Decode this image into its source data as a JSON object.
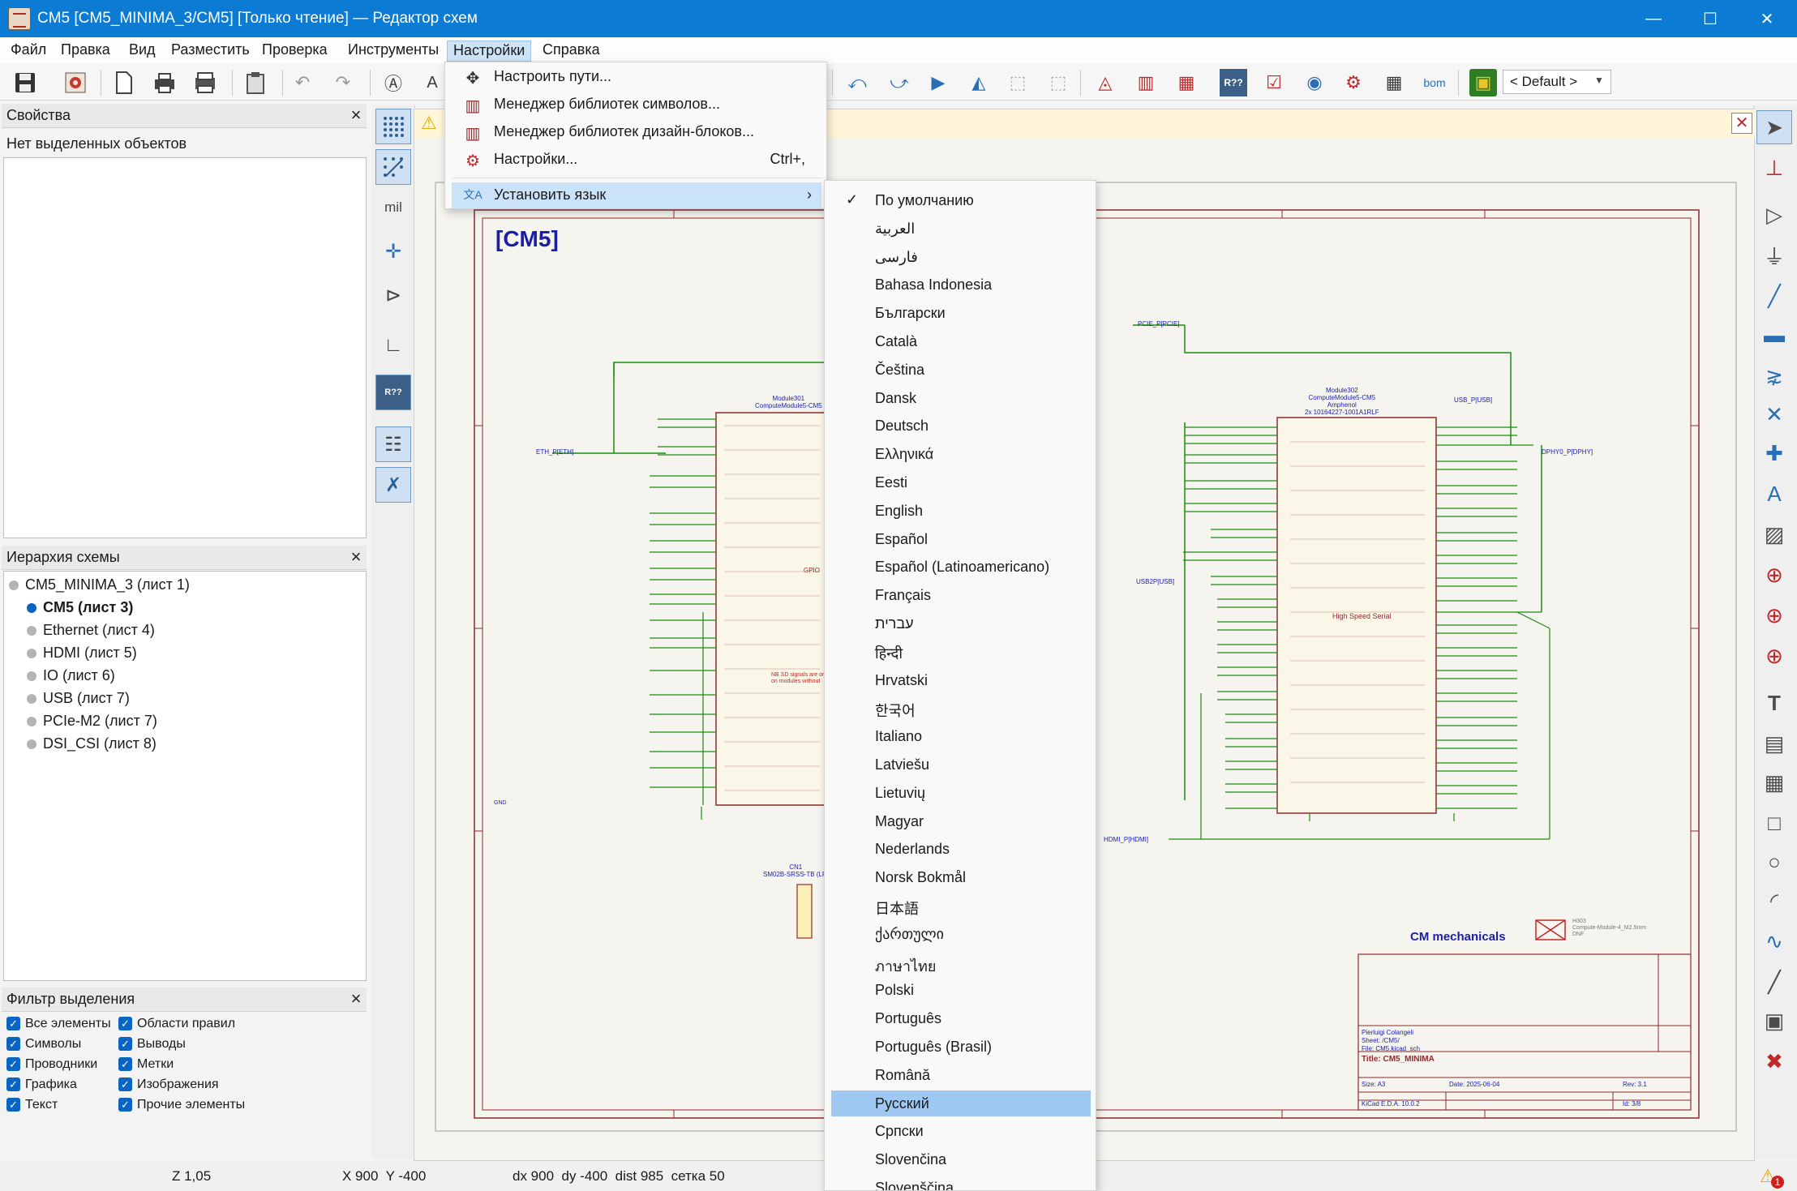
{
  "window": {
    "title": "CM5 [CM5_MINIMA_3/CM5] [Только чтение] — Редактор схем",
    "minimize": "—",
    "maximize": "☐",
    "close": "✕"
  },
  "menubar": [
    "Файл",
    "Правка",
    "Вид",
    "Разместить",
    "Проверка",
    "Инструменты",
    "Настройки",
    "Справка"
  ],
  "toolbar": {
    "scheme_dropdown": "< Default >"
  },
  "properties_panel": {
    "title": "Свойства",
    "empty_text": "Нет выделенных объектов"
  },
  "hierarchy_panel": {
    "title": "Иерархия схемы",
    "items": [
      {
        "label": "CM5_MINIMA_3 (лист 1)",
        "level": 0
      },
      {
        "label": "CM5 (лист 3)",
        "level": 1,
        "current": true
      },
      {
        "label": "Ethernet (лист 4)",
        "level": 1
      },
      {
        "label": "HDMI (лист 5)",
        "level": 1
      },
      {
        "label": "IO (лист 6)",
        "level": 1
      },
      {
        "label": "USB (лист 7)",
        "level": 1
      },
      {
        "label": "PCIe-M2 (лист 7)",
        "level": 1
      },
      {
        "label": "DSI_CSI (лист 8)",
        "level": 1
      }
    ]
  },
  "filter_panel": {
    "title": "Фильтр выделения",
    "left": [
      "Все элементы",
      "Символы",
      "Проводники",
      "Графика",
      "Текст"
    ],
    "right": [
      "Области правил",
      "Выводы",
      "Метки",
      "Изображения",
      "Прочие элементы"
    ]
  },
  "settings_menu": {
    "items": [
      {
        "icon": "move-arrows-icon",
        "label": "Настроить пути...",
        "shortcut": ""
      },
      {
        "icon": "library-icon",
        "label": "Менеджер библиотек символов...",
        "shortcut": ""
      },
      {
        "icon": "library-icon",
        "label": "Менеджер библиотек дизайн-блоков...",
        "shortcut": ""
      },
      {
        "icon": "gear-icon",
        "label": "Настройки...",
        "shortcut": "Ctrl+,"
      },
      {
        "icon": "language-icon",
        "label": "Установить язык",
        "shortcut": "",
        "submenu": true
      }
    ]
  },
  "language_menu": {
    "checked_index": 0,
    "highlighted_index": 32,
    "items": [
      "По умолчанию",
      "العربية",
      "فارسی",
      "Bahasa Indonesia",
      "Български",
      "Català",
      "Čeština",
      "Dansk",
      "Deutsch",
      "Ελληνικά",
      "Eesti",
      "English",
      "Español",
      "Español (Latinoamericano)",
      "Français",
      "עברית",
      "हिन्दी",
      "Hrvatski",
      "한국어",
      "Italiano",
      "Latviešu",
      "Lietuvių",
      "Magyar",
      "Nederlands",
      "Norsk Bokmål",
      "日本語",
      "ქართული",
      "ภาษาไทย",
      "Polski",
      "Português",
      "Português (Brasil)",
      "Română",
      "Русский",
      "Српски",
      "Slovenčina",
      "Slovenščina"
    ]
  },
  "canvas": {
    "sheet_title": "[CM5]",
    "module_left": "Module301\nComputeModule5-CM5",
    "module_right": "Module302\nComputeModule5-CM5\nAmphenol\n2x 10164227-1001A1RLF",
    "high_speed_label": "High Speed Serial",
    "cm_mechanicals": "CM mechanicals",
    "title_block": {
      "author": "Pierluigi Colangeli",
      "sheet": "Sheet: /CM5/",
      "file": "File: CM5.kicad_sch",
      "title": "Title: CM5_MINIMA",
      "size": "Size: A3",
      "date": "Date: 2025-06-04",
      "rev": "Rev: 3.1",
      "kicad": "KiCad E.D.A. 10.0.2",
      "id": "Id: 3/8"
    },
    "small_labels": {
      "eth": "ETH_P[ETH]",
      "pcie": "PCIE_P[PCIE]",
      "usb2p": "USB2P[USB]",
      "hdmi": "HDMI_P[HDMI]",
      "usb_p": "USB_P[USB]",
      "dphy": "DPHY0_P[DPHY]",
      "cn1": "CN1\nSM02B-SRSS-TB (LF)",
      "h303": "H303\nCompute-Module-4_M2.5mm\nDNF",
      "gpio": "GPIO",
      "gnd": "GND",
      "sd_note": "NB SD signals are only\non modules without"
    }
  },
  "statusbar": {
    "zoom": "Z 1,05",
    "xy": "X 900  Y -400",
    "delta": "dx 900  dy -400  dist 985  сетка 50",
    "warn_count": "1"
  },
  "colors": {
    "titlebar": "#0b7bd3",
    "wire": "#1a8a12",
    "sheet_border": "#8f2a2a",
    "title_blue": "#1b1fa6",
    "highlight": "#9fc9f2"
  }
}
